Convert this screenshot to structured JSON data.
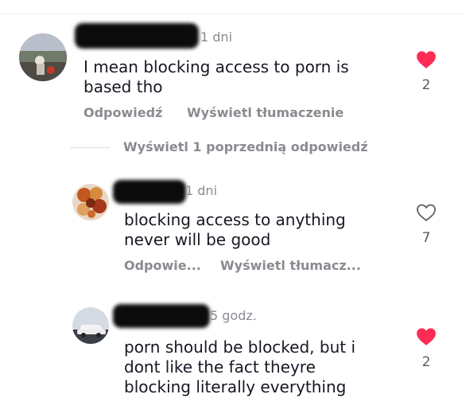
{
  "comments": [
    {
      "time": "1 dni",
      "text": "I mean blocking access to porn is\nbased tho",
      "like_count": "2",
      "liked": true,
      "actions": {
        "reply": "Odpowiedź",
        "translate": "Wyświetl tłumaczenie"
      }
    },
    {
      "time": "1 dni",
      "text": "blocking access to anything\nnever will be good",
      "like_count": "7",
      "liked": false,
      "actions": {
        "reply": "Odpowie...",
        "translate": "Wyświetl tłumacz..."
      }
    },
    {
      "time": "5 godz.",
      "text": "porn should be blocked, but i\ndont like the fact theyre\nblocking literally everything",
      "like_count": "2",
      "liked": true
    }
  ],
  "view_previous_replies": "Wyświetl 1 poprzednią odpowiedź",
  "colors": {
    "liked": "#fe2c55",
    "muted": "#8a8b91",
    "text": "#161823"
  },
  "icons": {
    "like": "heart-icon"
  }
}
